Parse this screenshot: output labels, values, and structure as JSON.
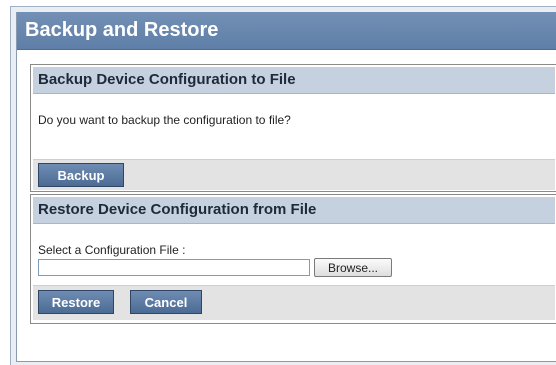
{
  "page": {
    "title": "Backup and Restore"
  },
  "backup": {
    "header": "Backup Device Configuration to File",
    "prompt": "Do you want to backup the configuration to file?",
    "backup_label": "Backup"
  },
  "restore": {
    "header": "Restore Device Configuration from File",
    "select_label": "Select a Configuration File :",
    "file_value": "",
    "browse_label": "Browse...",
    "restore_label": "Restore",
    "cancel_label": "Cancel"
  }
}
